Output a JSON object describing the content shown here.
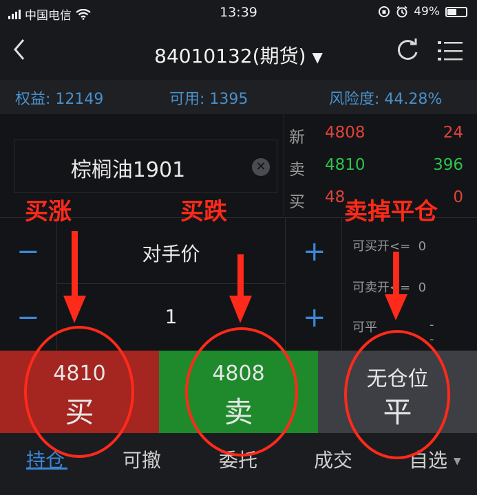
{
  "status_bar": {
    "carrier": "中国电信",
    "time": "13:39",
    "battery": "49%"
  },
  "nav": {
    "title": "84010132(期货)"
  },
  "account": {
    "equity_label": "权益:",
    "equity": "12149",
    "avail_label": "可用:",
    "avail": "1395",
    "risk_label": "风险度:",
    "risk": "44.28%"
  },
  "contract": {
    "name": "棕榈油1901"
  },
  "quotes": {
    "latest": {
      "label": "新",
      "price": "4808",
      "volume": "24"
    },
    "ask": {
      "label": "卖",
      "price": "4810",
      "volume": "396"
    },
    "bid": {
      "label": "买",
      "price": "48",
      "volume": "0"
    }
  },
  "order": {
    "price_type": "对手价",
    "quantity": "1",
    "minus": "−",
    "plus": "+"
  },
  "limits": {
    "can_buy_open_label": "可买开<=",
    "can_buy_open": "0",
    "can_sell_open_label": "可卖开<=",
    "can_sell_open": "0",
    "can_close_label": "可平",
    "can_close": "--"
  },
  "actions": {
    "buy": {
      "price": "4810",
      "label": "买"
    },
    "sell": {
      "price": "4808",
      "label": "卖"
    },
    "close": {
      "price": "无仓位",
      "label": "平"
    }
  },
  "tabs": [
    {
      "label": "持仓"
    },
    {
      "label": "可撤"
    },
    {
      "label": "委托"
    },
    {
      "label": "成交"
    },
    {
      "label": "自选"
    }
  ],
  "annotations": {
    "buy_up": "买涨",
    "buy_down": "买跌",
    "sell_close": "卖掉平仓"
  },
  "colors": {
    "buy_bg": "#a52520",
    "sell_bg": "#1f8a2c",
    "close_bg": "#3d3f44",
    "accent": "#3a86d6",
    "annotation": "#ff2a1a"
  }
}
